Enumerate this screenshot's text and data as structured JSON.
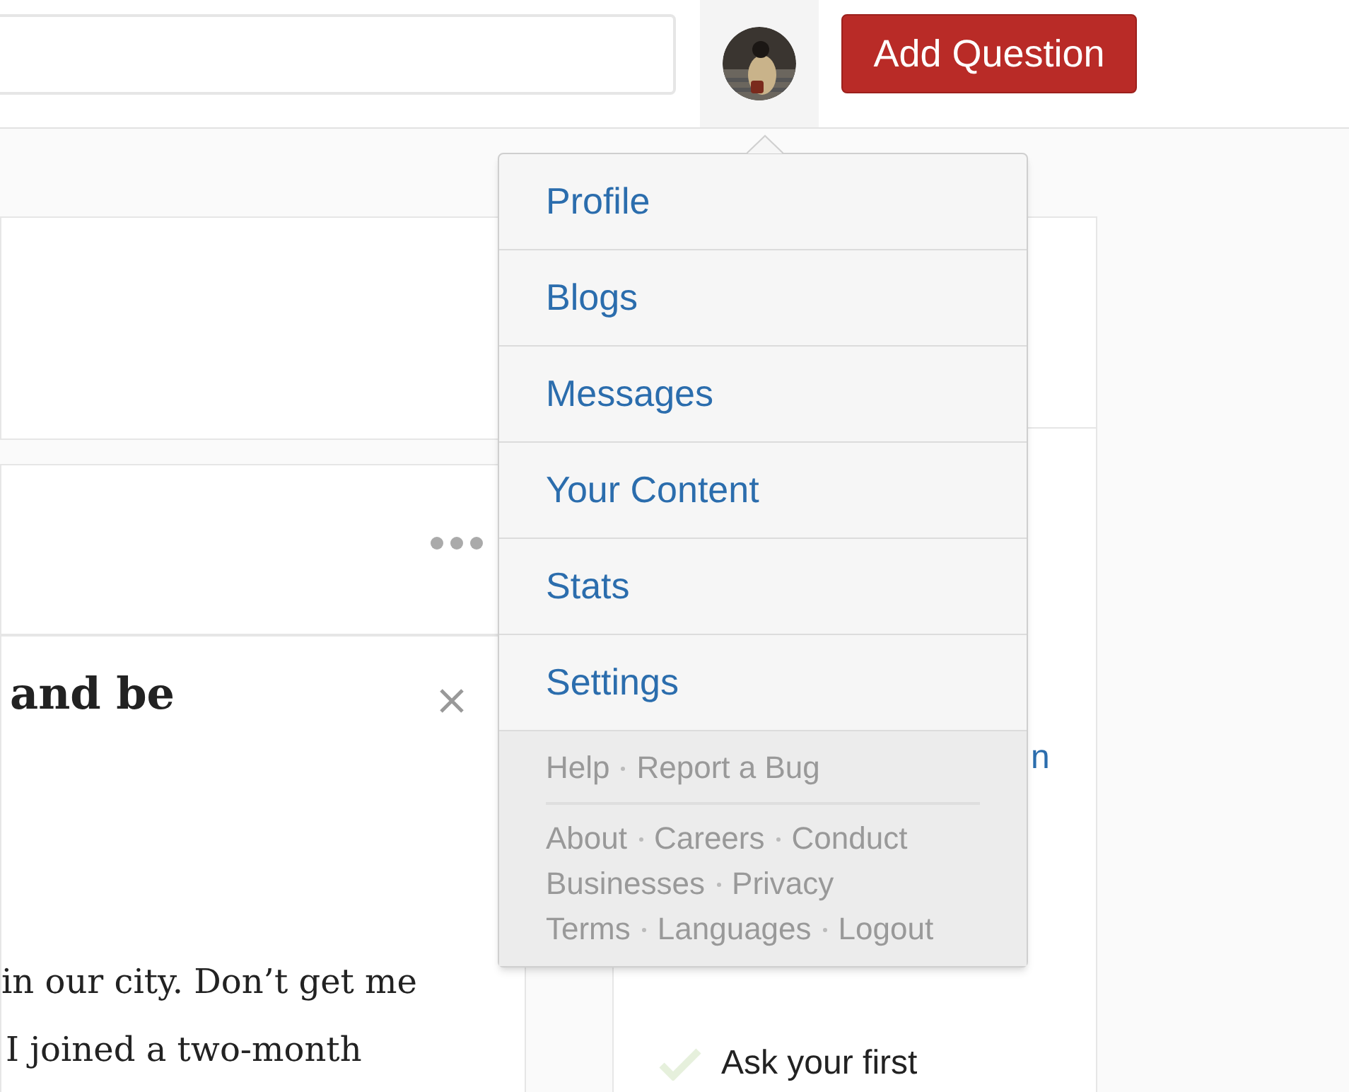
{
  "header": {
    "add_question": "Add Question"
  },
  "feed": {
    "heading": "and be",
    "body_lines": [
      "in our city. Don’t get me",
      "I joined a two-month"
    ]
  },
  "side_card": {
    "link_fragment": "n",
    "steps": [
      {
        "label": "Ask your first",
        "done": true
      }
    ]
  },
  "menu": {
    "items": [
      {
        "label": "Profile"
      },
      {
        "label": "Blogs"
      },
      {
        "label": "Messages"
      },
      {
        "label": "Your Content"
      },
      {
        "label": "Stats"
      },
      {
        "label": "Settings"
      }
    ],
    "footer_rows": [
      [
        "Help",
        "Report a Bug"
      ],
      [
        "About",
        "Careers",
        "Conduct"
      ],
      [
        "Businesses",
        "Privacy"
      ],
      [
        "Terms",
        "Languages",
        "Logout"
      ]
    ]
  }
}
